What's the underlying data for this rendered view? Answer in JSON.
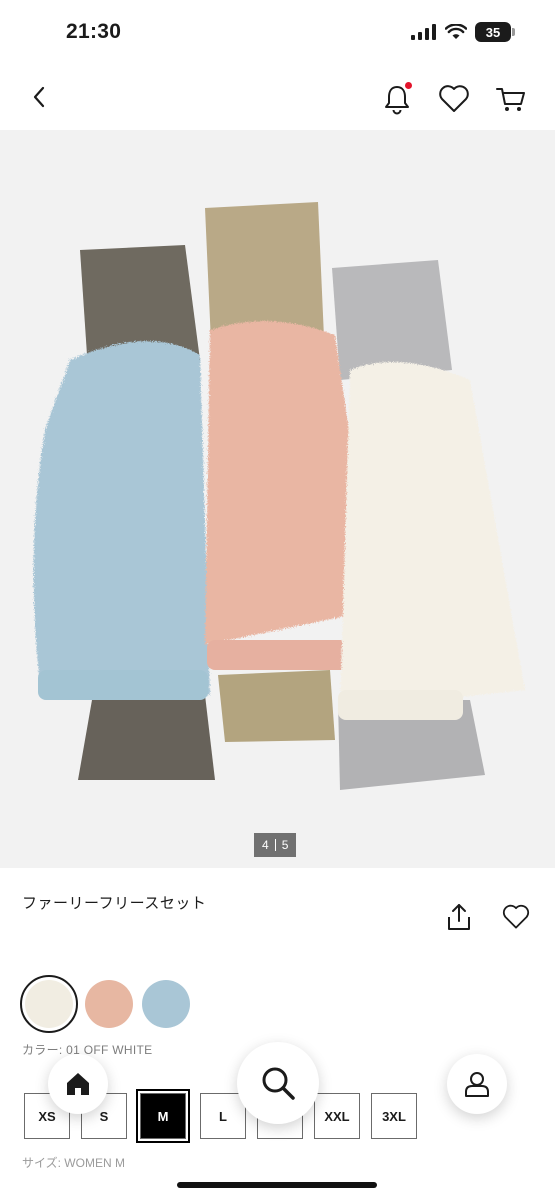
{
  "status": {
    "time": "21:30",
    "battery": "35"
  },
  "nav": {
    "back_icon": "chevron-left-icon",
    "bell_icon": "bell-icon",
    "wishlist_icon": "heart-icon",
    "cart_icon": "cart-icon",
    "notification_dot_color": "#e3132b"
  },
  "gallery": {
    "current": "4",
    "total": "5"
  },
  "product": {
    "title": "ファーリーフリースセット"
  },
  "colors": {
    "label": "カラー: 01 OFF WHITE",
    "swatches": [
      {
        "name": "OFF WHITE",
        "color": "#f1ede2",
        "selected": true
      },
      {
        "name": "PINK",
        "color": "#e7b7a2",
        "selected": false
      },
      {
        "name": "BLUE",
        "color": "#a9c6d6",
        "selected": false
      }
    ]
  },
  "sizes": {
    "options": [
      "XS",
      "S",
      "M",
      "L",
      "XL",
      "XXL",
      "3XL"
    ],
    "selected": "M",
    "subtext": "サイズ: WOMEN M"
  },
  "fabs": {
    "home_icon": "home-icon",
    "search_icon": "search-icon",
    "account_icon": "person-icon"
  }
}
